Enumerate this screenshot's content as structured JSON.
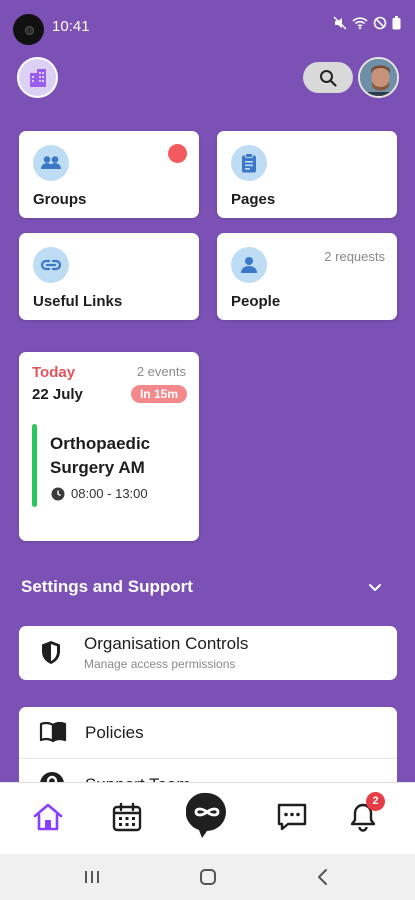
{
  "status_bar": {
    "time": "10:41"
  },
  "header": {
    "org_logo_icon": "building-icon",
    "search_icon": "search-icon",
    "avatar_icon": "user-avatar"
  },
  "tiles": [
    {
      "label": "Groups",
      "icon": "groups-icon",
      "note": "",
      "has_dot": true
    },
    {
      "label": "Pages",
      "icon": "clipboard-icon",
      "note": ""
    },
    {
      "label": "Useful Links",
      "icon": "link-icon",
      "note": ""
    },
    {
      "label": "People",
      "icon": "person-icon",
      "note": "2 requests"
    }
  ],
  "event": {
    "day_label": "Today",
    "count": "2 events",
    "date": "22 July",
    "badge": "In 15m",
    "title": "Orthopaedic Surgery AM",
    "time": "08:00 - 13:00"
  },
  "settings_section": {
    "title": "Settings and Support",
    "org_controls": {
      "title": "Organisation Controls",
      "subtitle": "Manage access permissions"
    },
    "items": [
      {
        "label": "Policies",
        "icon": "book-icon"
      },
      {
        "label": "Support Team",
        "icon": "help-icon"
      }
    ]
  },
  "tab_bar": {
    "tabs": [
      "home-icon",
      "calendar-icon",
      "app-logo-icon",
      "chat-icon",
      "bell-icon"
    ],
    "notifications_badge": "2"
  },
  "colors": {
    "background": "#7b51b5",
    "accent_red": "#e3535b",
    "event_bar": "#2ec45f",
    "home_active": "#8a3ffc"
  }
}
